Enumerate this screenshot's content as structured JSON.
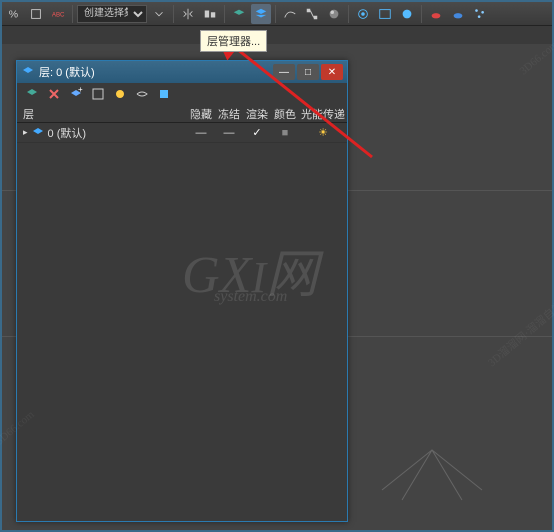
{
  "toolbar": {
    "dropdown_value": "创建选择集"
  },
  "tooltip": {
    "text": "层管理器..."
  },
  "panel": {
    "title": "层: 0 (默认)",
    "columns": {
      "name": "层",
      "hide": "隐藏",
      "freeze": "冻结",
      "render": "渲染",
      "color": "颜色",
      "radiosity": "光能传递"
    },
    "layers": [
      {
        "name": "0 (默认)",
        "hide": "—",
        "freeze": "—",
        "render": "✓",
        "color": "■",
        "radiosity": "☀"
      }
    ]
  },
  "watermark": {
    "main_g": "G",
    "main_x": "X",
    "main_i": "I",
    "main_cn": "网",
    "sub": "system.com",
    "diag1": "3D66.com",
    "diag2": "3D66.com",
    "diag3": "3D溜溜网·溜溜自学网"
  }
}
